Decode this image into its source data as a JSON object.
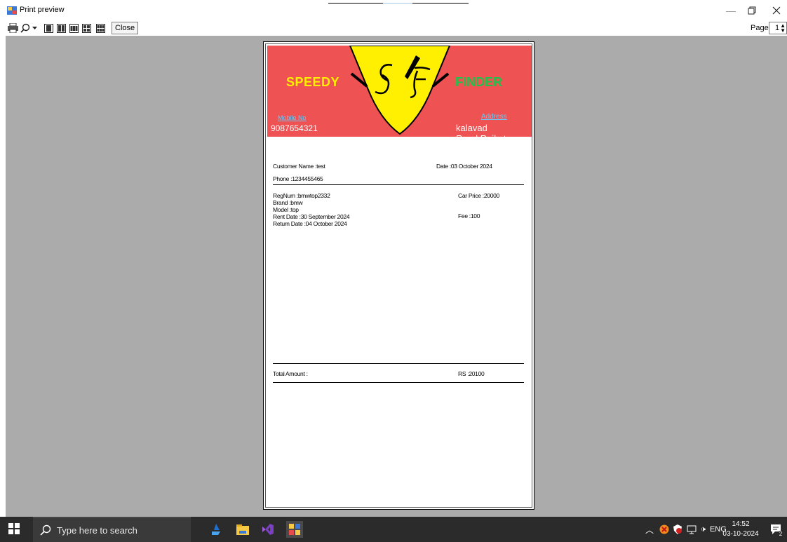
{
  "window": {
    "title": "Print preview"
  },
  "toolbar": {
    "close_label": "Close",
    "page_label": "Page",
    "page_value": "1",
    "icons": [
      "print-icon",
      "zoom-icon",
      "dropdown-arrow-icon",
      "one-page-icon",
      "two-pages-icon",
      "three-pages-icon",
      "four-pages-icon",
      "six-pages-icon"
    ]
  },
  "receipt": {
    "brand_left": "SPEEDY",
    "brand_right": "FINDER",
    "logo_text": "S F",
    "mobile_label": "Mobile No",
    "mobile_value": "9087654321",
    "address_label": "Address",
    "address_value": "kalavad Road,Rajkot",
    "customer_name": "Customer Name :test",
    "date": "Date :03 October 2024",
    "phone": "Phone :1234455465",
    "reg_num": "RegNum :bmwtop2332",
    "brand": "Brand :bmw",
    "model": "Model :top",
    "rent_date": "Rent Date :30 September 2024",
    "return_date": "Return Date :04 October 2024",
    "car_price": "Car Price :20000",
    "fee": "Fee :100",
    "total_label": "Total Amount :",
    "total_value": "RS :20100"
  },
  "taskbar": {
    "search_placeholder": "Type here to search",
    "lang": "ENG",
    "time": "14:52",
    "date": "03-10-2024",
    "notification_count": "2"
  },
  "colors": {
    "banner": "#ee5253",
    "shield": "#ffef00",
    "brand_left": "#ffef00",
    "brand_right": "#22c24a",
    "link": "#6ec6f5",
    "preview_bg": "#ababab",
    "taskbar": "#2b2b2b"
  }
}
